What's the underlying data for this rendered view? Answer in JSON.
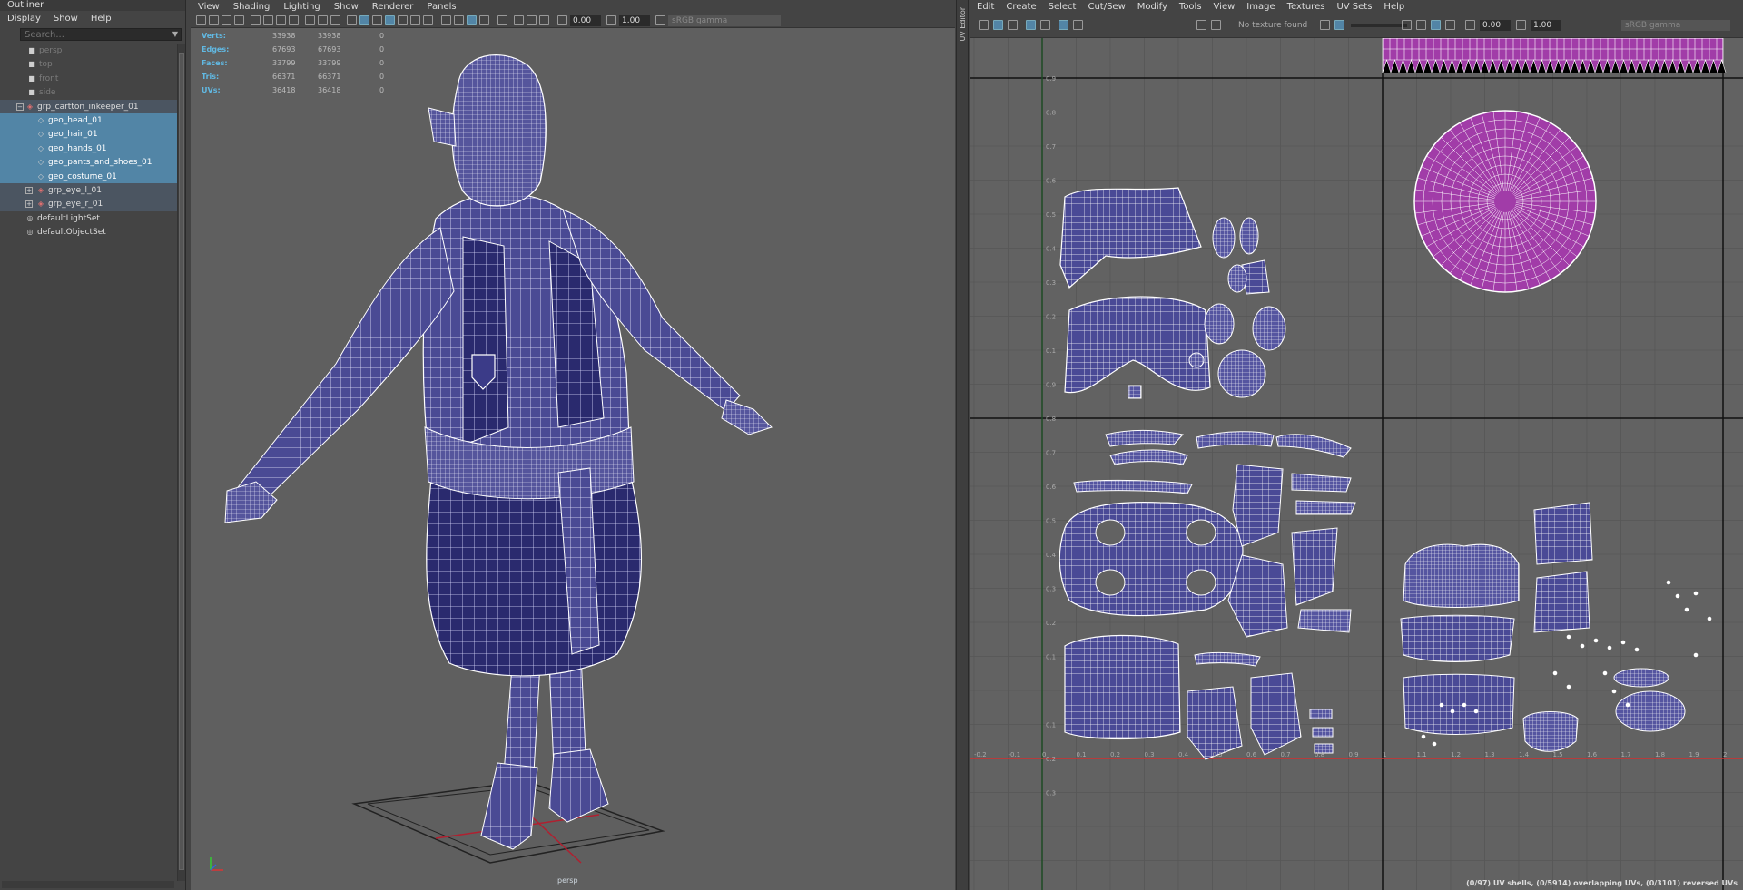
{
  "outliner": {
    "title": "Outliner",
    "menu": [
      "Display",
      "Show",
      "Help"
    ],
    "search_placeholder": "Search...",
    "items": [
      {
        "label": "persp",
        "icon": "camera-icon"
      },
      {
        "label": "top",
        "icon": "camera-icon"
      },
      {
        "label": "front",
        "icon": "camera-icon"
      },
      {
        "label": "side",
        "icon": "camera-icon"
      },
      {
        "label": "grp_cartton_inkeeper_01",
        "icon": "group-icon"
      },
      {
        "label": "geo_head_01",
        "icon": "mesh-icon"
      },
      {
        "label": "geo_hair_01",
        "icon": "mesh-icon"
      },
      {
        "label": "geo_hands_01",
        "icon": "mesh-icon"
      },
      {
        "label": "geo_pants_and_shoes_01",
        "icon": "mesh-icon"
      },
      {
        "label": "geo_costume_01",
        "icon": "mesh-icon"
      },
      {
        "label": "grp_eye_l_01",
        "icon": "group-icon"
      },
      {
        "label": "grp_eye_r_01",
        "icon": "group-icon"
      },
      {
        "label": "defaultLightSet",
        "icon": "set-icon"
      },
      {
        "label": "defaultObjectSet",
        "icon": "set-icon"
      }
    ]
  },
  "viewport": {
    "menu": [
      "View",
      "Shading",
      "Lighting",
      "Show",
      "Renderer",
      "Panels"
    ],
    "exposure": "0.00",
    "gamma": "1.00",
    "color_space": "sRGB gamma",
    "camera_label": "persp",
    "hud": [
      {
        "label": "Verts:",
        "v1": "33938",
        "v2": "33938",
        "v3": "0"
      },
      {
        "label": "Edges:",
        "v1": "67693",
        "v2": "67693",
        "v3": "0"
      },
      {
        "label": "Faces:",
        "v1": "33799",
        "v2": "33799",
        "v3": "0"
      },
      {
        "label": "Tris:",
        "v1": "66371",
        "v2": "66371",
        "v3": "0"
      },
      {
        "label": "UVs:",
        "v1": "36418",
        "v2": "36418",
        "v3": "0"
      }
    ]
  },
  "uv_editor": {
    "panel_title": "UV Editor",
    "menu": [
      "Edit",
      "Create",
      "Select",
      "Cut/Sew",
      "Modify",
      "Tools",
      "View",
      "Image",
      "Textures",
      "UV Sets",
      "Help"
    ],
    "texture_status": "No texture found",
    "exposure": "0.00",
    "gamma": "1.00",
    "color_space": "sRGB gamma",
    "status": "(0/97) UV shells, (0/5914) overlapping UVs, (0/3101) reversed UVs",
    "x_ticks": [
      "-0.2",
      "-0.1",
      "0",
      "0.1",
      "0.2",
      "0.3",
      "0.4",
      "0.5",
      "0.6",
      "0.7",
      "0.8",
      "0.9",
      "1",
      "1.1",
      "1.2",
      "1.3",
      "1.4",
      "1.5",
      "1.6",
      "1.7",
      "1.8",
      "1.9",
      "2"
    ],
    "y_ticks": [
      "0.9",
      "0.8",
      "0.7",
      "0.6",
      "0.5",
      "0.4",
      "0.3",
      "0.2",
      "0.1",
      "0.9",
      "0.8",
      "0.7",
      "0.6",
      "0.5",
      "0.4",
      "0.3",
      "0.2",
      "0.1",
      "0.1",
      "0.2",
      "0.3"
    ],
    "colors": {
      "shell": "#4a4a96",
      "selected_shell": "#a13ca8",
      "wire": "#ffffff",
      "u_axis": "#d23030",
      "v_axis": "#30a040"
    }
  }
}
